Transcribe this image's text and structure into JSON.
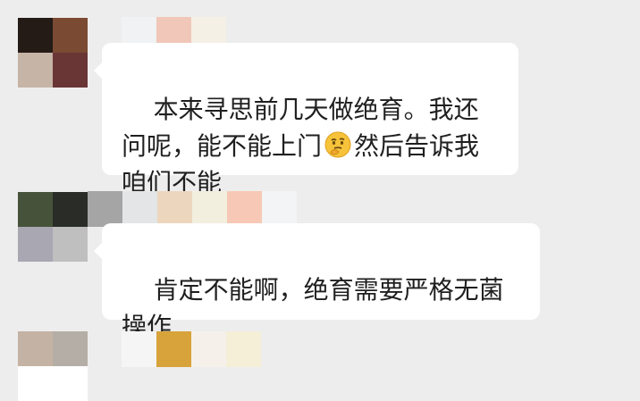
{
  "colors": {
    "background": "#ededed",
    "bubble": "#ffffff",
    "text": "#1f1f1f"
  },
  "messages": [
    {
      "id": "msg1",
      "avatar_colors": [
        "#241a16",
        "#7a4a32",
        "#c6b4a7",
        "#6a3535"
      ],
      "name_blur_colors": [
        "#f0f2f4",
        "#f0c7b8",
        "#f5f0e6"
      ],
      "text_before_emoji": "本来寻思前几天做绝育。我还问呢，能不能上门",
      "emoji": "thinking-face-icon",
      "text_after_emoji": "然后告诉我咱们不能"
    },
    {
      "id": "msg2",
      "avatar_colors": [
        "#46533a",
        "#2a2c27",
        "#a9a7b2",
        "#bfbfbf"
      ],
      "name_blur_colors": [
        "#a5a5a5",
        "#e3e5e6",
        "#ecd7be",
        "#f3efdf",
        "#f7c8b5",
        "#f2f4f5"
      ],
      "text": "肯定不能啊，绝育需要严格无菌操作"
    },
    {
      "id": "msg3",
      "avatar_colors": [
        "#c4b3a4",
        "#b5aea6",
        "#ffffff",
        "#ffffff"
      ],
      "name_blur_colors": [
        "#f5f5f5",
        "#d8a33a",
        "#f5f0ea",
        "#f5efd8"
      ]
    }
  ]
}
